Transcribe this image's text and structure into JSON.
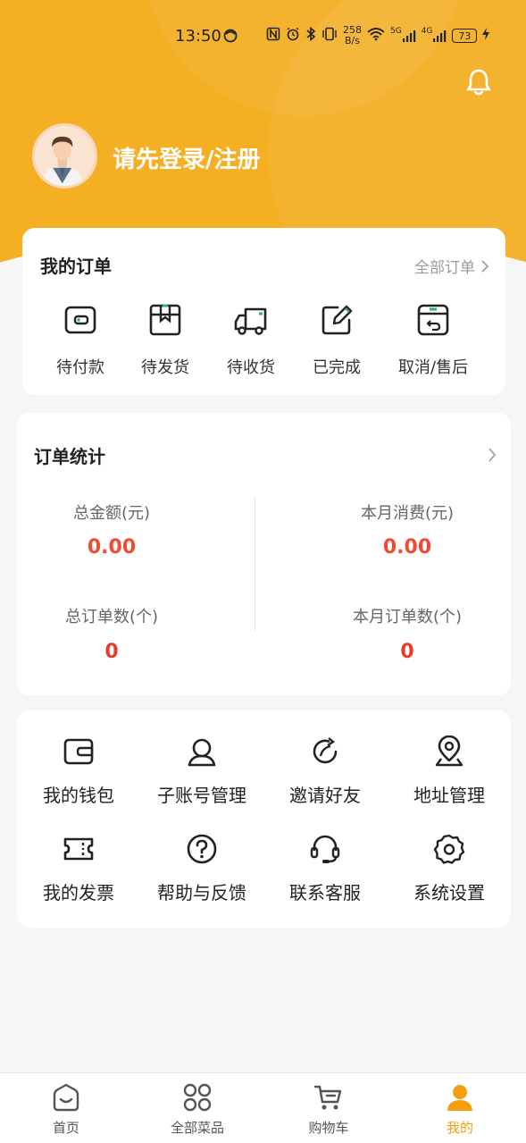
{
  "status_bar": {
    "time": "13:50",
    "net_speed_value": "258",
    "net_speed_unit": "B/s",
    "sig1": "5G",
    "sig2": "4G",
    "battery": "73"
  },
  "header": {
    "login_text": "请先登录/注册",
    "bell_icon": "bell-icon",
    "accent_color": "#f4af22"
  },
  "orders": {
    "title": "我的订单",
    "all_orders_label": "全部订单",
    "items": [
      {
        "label": "待付款",
        "icon": "wallet-icon"
      },
      {
        "label": "待发货",
        "icon": "package-icon"
      },
      {
        "label": "待收货",
        "icon": "truck-icon"
      },
      {
        "label": "已完成",
        "icon": "edit-icon"
      },
      {
        "label": "取消/售后",
        "icon": "return-box-icon"
      }
    ]
  },
  "stats": {
    "title": "订单统计",
    "total_amount_label": "总金额(元)",
    "total_amount_value": "0.00",
    "month_spend_label": "本月消费(元)",
    "month_spend_value": "0.00",
    "total_orders_label": "总订单数(个)",
    "total_orders_value": "0",
    "month_orders_label": "本月订单数(个)",
    "month_orders_value": "0",
    "value_color": "#f24b33"
  },
  "menu": {
    "items": [
      {
        "label": "我的钱包",
        "icon": "wallet-icon"
      },
      {
        "label": "子账号管理",
        "icon": "user-icon"
      },
      {
        "label": "邀请好友",
        "icon": "share-icon"
      },
      {
        "label": "地址管理",
        "icon": "location-icon"
      },
      {
        "label": "我的发票",
        "icon": "ticket-icon"
      },
      {
        "label": "帮助与反馈",
        "icon": "help-icon"
      },
      {
        "label": "联系客服",
        "icon": "headset-icon"
      },
      {
        "label": "系统设置",
        "icon": "gear-icon"
      }
    ]
  },
  "tabbar": {
    "items": [
      {
        "label": "首页",
        "icon": "home-icon"
      },
      {
        "label": "全部菜品",
        "icon": "grid-icon"
      },
      {
        "label": "购物车",
        "icon": "cart-icon"
      },
      {
        "label": "我的",
        "icon": "person-icon"
      }
    ],
    "active_color": "#f4a00e"
  }
}
